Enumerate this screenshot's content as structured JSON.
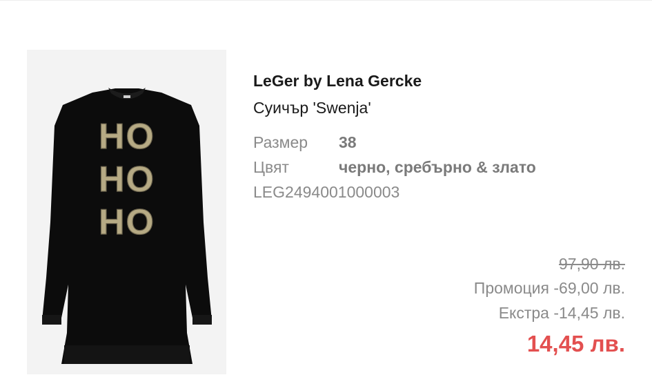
{
  "product": {
    "brand": "LeGer by Lena Gercke",
    "name": "Суичър 'Swenja'",
    "image_print": [
      "HO",
      "HO",
      "HO"
    ]
  },
  "attributes": {
    "size_label": "Размер",
    "size_value": "38",
    "color_label": "Цвят",
    "color_value": "черно, сребърно & злато"
  },
  "sku": "LEG2494001000003",
  "pricing": {
    "original_price": "97,90 лв.",
    "promotion": "Промоция -69,00 лв.",
    "extra": "Екстра -14,45 лв.",
    "final_price": "14,45 лв.",
    "final_price_color": "#e35050"
  },
  "icons": {
    "product_image": "black-sweatshirt-with-sequin-lettering"
  }
}
